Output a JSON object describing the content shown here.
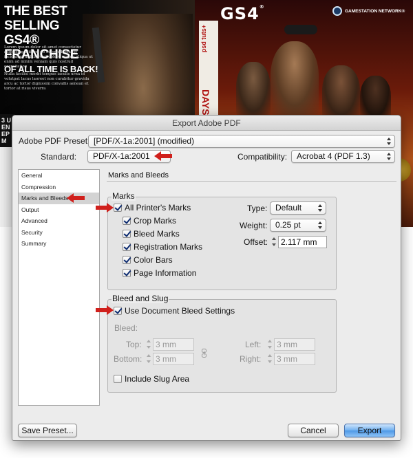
{
  "poster": {
    "headline": [
      "THE BEST SELLING",
      "GS4® FRANCHISE",
      "OF ALL TIME IS BACK!"
    ],
    "logo": "GS4",
    "network": "GAMESTATION NETWORK®",
    "box_brand": "psd tuts+",
    "box_title": "DAYS of",
    "side_strip": [
      "3 U",
      "EN",
      "EP",
      "M"
    ]
  },
  "dialog": {
    "title": "Export Adobe PDF",
    "preset_label": "Adobe PDF Preset:",
    "preset_value": "[PDF/X-1a:2001] (modified)",
    "standard_label": "Standard:",
    "standard_value": "PDF/X-1a:2001",
    "compat_label": "Compatibility:",
    "compat_value": "Acrobat 4 (PDF 1.3)",
    "sidebar": [
      {
        "label": "General",
        "selected": false
      },
      {
        "label": "Compression",
        "selected": false
      },
      {
        "label": "Marks and Bleeds",
        "selected": true
      },
      {
        "label": "Output",
        "selected": false
      },
      {
        "label": "Advanced",
        "selected": false
      },
      {
        "label": "Security",
        "selected": false
      },
      {
        "label": "Summary",
        "selected": false
      }
    ],
    "pane_title": "Marks and Bleeds",
    "marks": {
      "title": "Marks",
      "all_printers": {
        "label": "All Printer's Marks",
        "checked": true
      },
      "crop": {
        "label": "Crop Marks",
        "checked": true
      },
      "bleed": {
        "label": "Bleed Marks",
        "checked": true
      },
      "registration": {
        "label": "Registration Marks",
        "checked": true
      },
      "color_bars": {
        "label": "Color Bars",
        "checked": true
      },
      "page_info": {
        "label": "Page Information",
        "checked": true
      },
      "type_label": "Type:",
      "type_value": "Default",
      "weight_label": "Weight:",
      "weight_value": "0.25 pt",
      "offset_label": "Offset:",
      "offset_value": "2.117 mm"
    },
    "bleed": {
      "title": "Bleed and Slug",
      "use_doc": {
        "label": "Use Document Bleed Settings",
        "checked": true
      },
      "bleed_label": "Bleed:",
      "top_label": "Top:",
      "top_value": "3 mm",
      "bottom_label": "Bottom:",
      "bottom_value": "3 mm",
      "left_label": "Left:",
      "left_value": "3 mm",
      "right_label": "Right:",
      "right_value": "3 mm",
      "slug": {
        "label": "Include Slug Area",
        "checked": false
      }
    },
    "buttons": {
      "save_preset": "Save Preset...",
      "cancel": "Cancel",
      "export": "Export"
    }
  },
  "colors": {
    "annotation_arrow": "#d0201c",
    "checkmark": "#0b2a6f",
    "primary_button": "#4d97e6"
  }
}
